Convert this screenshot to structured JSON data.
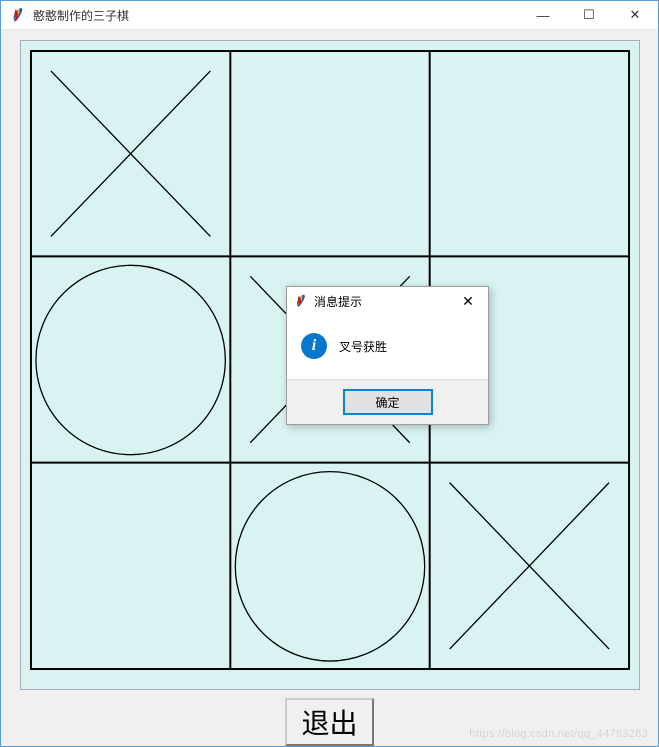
{
  "window": {
    "title": "憨憨制作的三子棋",
    "buttons": {
      "min": "—",
      "max": "☐",
      "close": "✕"
    }
  },
  "board": {
    "bg_color": "#d9f3f3",
    "line_color": "#000000",
    "cells": {
      "r0c0": "X",
      "r0c1": "",
      "r0c2": "",
      "r1c0": "O",
      "r1c1": "X",
      "r1c2": "",
      "r2c0": "",
      "r2c1": "O",
      "r2c2": "X"
    }
  },
  "buttons": {
    "quit_label": "退出"
  },
  "dialog": {
    "title": "消息提示",
    "message": "叉号获胜",
    "ok_label": "确定",
    "close": "✕"
  },
  "watermark": "https://blog.csdn.net/qq_44793283"
}
